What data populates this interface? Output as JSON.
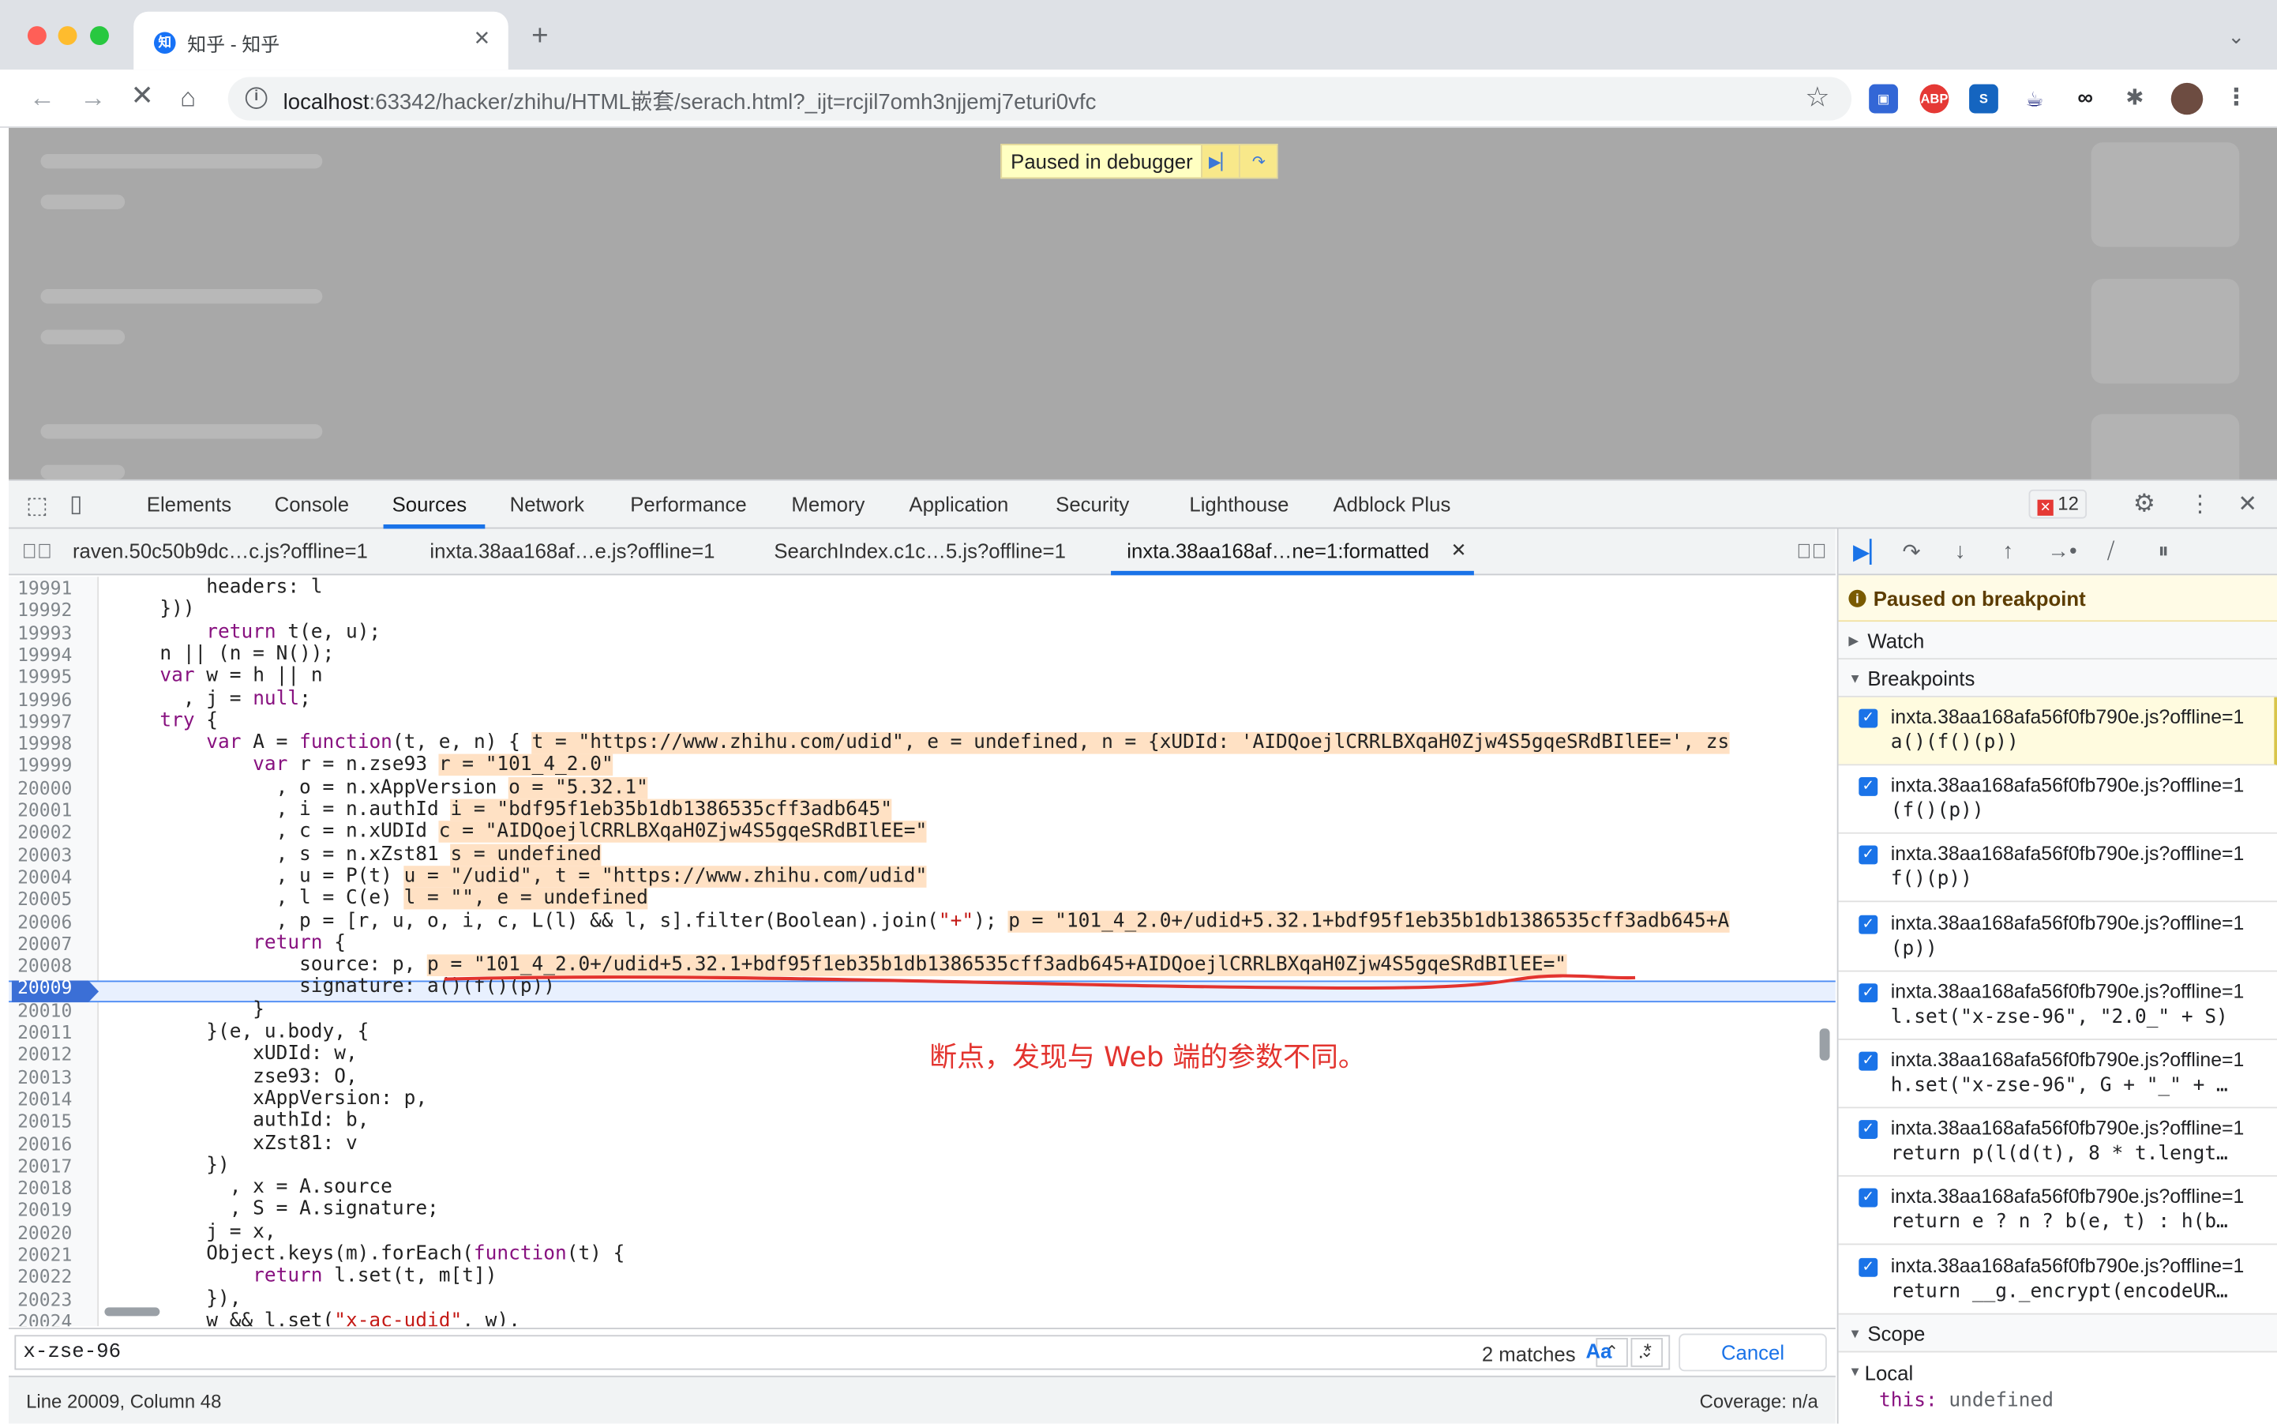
{
  "browser": {
    "tab_title": "知乎 - 知乎",
    "tab_favicon": "知",
    "url_host": "localhost",
    "url_rest": ":63342/hacker/zhihu/HTML嵌套/serach.html?_ijt=rcjil7omh3njjemj7eturi0vfc"
  },
  "page": {
    "debugger_banner": "Paused in debugger"
  },
  "devtools": {
    "tabs": [
      "Elements",
      "Console",
      "Sources",
      "Network",
      "Performance",
      "Memory",
      "Application",
      "Security",
      "Lighthouse",
      "Adblock Plus"
    ],
    "selected_tab": "Sources",
    "error_count": "12",
    "file_tabs": [
      "raven.50c50b9dc…c.js?offline=1",
      "inxta.38aa168af…e.js?offline=1",
      "SearchIndex.c1c…5.js?offline=1",
      "inxta.38aa168af…ne=1:formatted"
    ],
    "selected_file_tab": "inxta.38aa168af…ne=1:formatted",
    "search": {
      "query": "x-zse-96",
      "matches": "2 matches",
      "case_label": "Aa",
      "regex_label": ".*",
      "cancel_label": "Cancel"
    },
    "status": {
      "position": "Line 20009, Column 48",
      "coverage": "Coverage: n/a"
    },
    "annotation": "断点，发现与 Web 端的参数不同。",
    "sidebar": {
      "paused_label": "Paused on breakpoint",
      "watch_label": "Watch",
      "breakpoints_label": "Breakpoints",
      "scope_label": "Scope",
      "local_label": "Local",
      "this_key": "this:",
      "this_value": "undefined",
      "breakpoints": [
        {
          "file": "inxta.38aa168afa56f0fb790e.js?offline=1",
          "code": "a()(f()(p))",
          "active": true
        },
        {
          "file": "inxta.38aa168afa56f0fb790e.js?offline=1",
          "code": "(f()(p))",
          "active": false
        },
        {
          "file": "inxta.38aa168afa56f0fb790e.js?offline=1",
          "code": "f()(p))",
          "active": false
        },
        {
          "file": "inxta.38aa168afa56f0fb790e.js?offline=1",
          "code": "(p))",
          "active": false
        },
        {
          "file": "inxta.38aa168afa56f0fb790e.js?offline=1",
          "code": "l.set(\"x-zse-96\", \"2.0_\" + S)",
          "active": false
        },
        {
          "file": "inxta.38aa168afa56f0fb790e.js?offline=1",
          "code": "h.set(\"x-zse-96\", G + \"_\" + …",
          "active": false
        },
        {
          "file": "inxta.38aa168afa56f0fb790e.js?offline=1",
          "code": "return p(l(d(t), 8 * t.lengt…",
          "active": false
        },
        {
          "file": "inxta.38aa168afa56f0fb790e.js?offline=1",
          "code": "return e ? n ? b(e, t) : h(b…",
          "active": false
        },
        {
          "file": "inxta.38aa168afa56f0fb790e.js?offline=1",
          "code": "return __g._encrypt(encodeUR…",
          "active": false
        }
      ]
    }
  },
  "code_lines": [
    {
      "n": "19991",
      "indent": "        ",
      "code": "headers: l",
      "hint": ""
    },
    {
      "n": "19992",
      "indent": "    ",
      "code": "}))",
      "hint": ""
    },
    {
      "n": "19993",
      "indent": "        ",
      "code": "return t(e, u);",
      "hint": ""
    },
    {
      "n": "19994",
      "indent": "    ",
      "code": "n || (n = N());",
      "hint": ""
    },
    {
      "n": "19995",
      "indent": "    ",
      "code": "var w = h || n",
      "hint": ""
    },
    {
      "n": "19996",
      "indent": "      ",
      "code": ", j = null;",
      "hint": ""
    },
    {
      "n": "19997",
      "indent": "    ",
      "code": "try {",
      "hint": ""
    },
    {
      "n": "19998",
      "indent": "        ",
      "code": "var A = function(t, e, n) {",
      "hint": "t = \"https://www.zhihu.com/udid\", e = undefined, n = {xUDId: 'AIDQoejlCRRLBXqaH0Zjw4S5gqeSRdBIlEE=', zs"
    },
    {
      "n": "19999",
      "indent": "            ",
      "code": "var r = n.zse93",
      "hint": "r = \"101_4_2.0\""
    },
    {
      "n": "20000",
      "indent": "              ",
      "code": ", o = n.xAppVersion",
      "hint": "o = \"5.32.1\""
    },
    {
      "n": "20001",
      "indent": "              ",
      "code": ", i = n.authId",
      "hint": "i = \"bdf95f1eb35b1db1386535cff3adb645\""
    },
    {
      "n": "20002",
      "indent": "              ",
      "code": ", c = n.xUDId",
      "hint": "c = \"AIDQoejlCRRLBXqaH0Zjw4S5gqeSRdBIlEE=\""
    },
    {
      "n": "20003",
      "indent": "              ",
      "code": ", s = n.xZst81",
      "hint": "s = undefined"
    },
    {
      "n": "20004",
      "indent": "              ",
      "code": ", u = P(t)",
      "hint": "u = \"/udid\", t = \"https://www.zhihu.com/udid\""
    },
    {
      "n": "20005",
      "indent": "              ",
      "code": ", l = C(e)",
      "hint": "l = \"\", e = undefined"
    },
    {
      "n": "20006",
      "indent": "              ",
      "code": ", p = [r, u, o, i, c, L(l) && l, s].filter(Boolean).join(\"+\");",
      "hint": "p = \"101_4_2.0+/udid+5.32.1+bdf95f1eb35b1db1386535cff3adb645+A"
    },
    {
      "n": "20007",
      "indent": "            ",
      "code": "return {",
      "hint": ""
    },
    {
      "n": "20008",
      "indent": "                ",
      "code": "source: p,",
      "hint": "p = \"101_4_2.0+/udid+5.32.1+bdf95f1eb35b1db1386535cff3adb645+AIDQoejlCRRLBXqaH0Zjw4S5gqeSRdBIlEE=\""
    },
    {
      "n": "20009",
      "indent": "                ",
      "code": "signature: a()(f()(p))",
      "hint": ""
    },
    {
      "n": "20010",
      "indent": "            ",
      "code": "}",
      "hint": ""
    },
    {
      "n": "20011",
      "indent": "        ",
      "code": "}(e, u.body, {",
      "hint": ""
    },
    {
      "n": "20012",
      "indent": "            ",
      "code": "xUDId: w,",
      "hint": ""
    },
    {
      "n": "20013",
      "indent": "            ",
      "code": "zse93: O,",
      "hint": ""
    },
    {
      "n": "20014",
      "indent": "            ",
      "code": "xAppVersion: p,",
      "hint": ""
    },
    {
      "n": "20015",
      "indent": "            ",
      "code": "authId: b,",
      "hint": ""
    },
    {
      "n": "20016",
      "indent": "            ",
      "code": "xZst81: v",
      "hint": ""
    },
    {
      "n": "20017",
      "indent": "        ",
      "code": "})",
      "hint": ""
    },
    {
      "n": "20018",
      "indent": "          ",
      "code": ", x = A.source",
      "hint": ""
    },
    {
      "n": "20019",
      "indent": "          ",
      "code": ", S = A.signature;",
      "hint": ""
    },
    {
      "n": "20020",
      "indent": "        ",
      "code": "j = x,",
      "hint": ""
    },
    {
      "n": "20021",
      "indent": "        ",
      "code": "Object.keys(m).forEach(function(t) {",
      "hint": ""
    },
    {
      "n": "20022",
      "indent": "            ",
      "code": "return l.set(t, m[t])",
      "hint": ""
    },
    {
      "n": "20023",
      "indent": "        ",
      "code": "}),",
      "hint": ""
    },
    {
      "n": "20024",
      "indent": "        ",
      "code": "w && l.set(\"x-ac-udid\", w),",
      "hint": ""
    }
  ],
  "current_line": "20009",
  "colors": {
    "accent": "#1a73e8",
    "annotation": "#e3342f",
    "paused_bg": "#ffffc2",
    "value_hint_bg": "#ffe1c4"
  }
}
